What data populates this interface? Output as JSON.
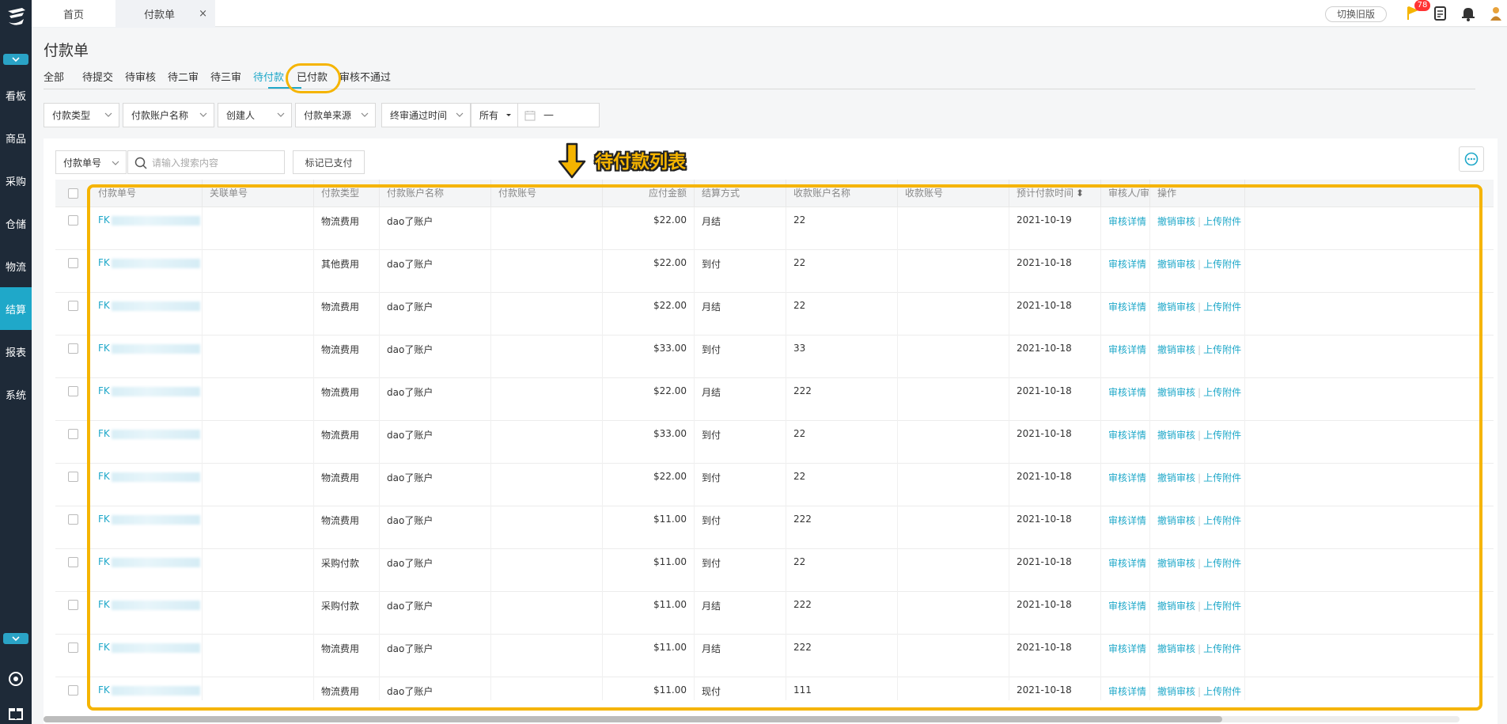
{
  "sidebar": {
    "items": [
      {
        "label": "看板",
        "active": false
      },
      {
        "label": "商品",
        "active": false
      },
      {
        "label": "采购",
        "active": false
      },
      {
        "label": "仓储",
        "active": false
      },
      {
        "label": "物流",
        "active": false
      },
      {
        "label": "结算",
        "active": true
      },
      {
        "label": "报表",
        "active": false
      },
      {
        "label": "系统",
        "active": false
      }
    ]
  },
  "topbar": {
    "tabs": [
      {
        "label": "首页"
      },
      {
        "label": "付款单",
        "closable": true
      }
    ],
    "close_glyph": "×",
    "old_version_label": "切换旧版",
    "flag_badge": "78"
  },
  "page": {
    "title": "付款单",
    "status_tabs": [
      {
        "label": "全部"
      },
      {
        "label": "待提交"
      },
      {
        "label": "待审核"
      },
      {
        "label": "待二审"
      },
      {
        "label": "待三审"
      },
      {
        "label": "待付款",
        "active": true
      },
      {
        "label": "已付款"
      },
      {
        "label": "审核不通过"
      }
    ],
    "filters": [
      "付款类型",
      "付款账户名称",
      "创建人",
      "付款单来源",
      "终审通过时间",
      "所有"
    ],
    "date_range_sep": "—"
  },
  "toolbar": {
    "search_field": "付款单号",
    "search_placeholder": "请输入搜索内容",
    "mark_paid_label": "标记已支付"
  },
  "annotation": {
    "text": "待付款列表"
  },
  "table": {
    "columns": [
      "付款单号",
      "关联单号",
      "付款类型",
      "付款账户名称",
      "付款账号",
      "应付金额",
      "结算方式",
      "收款账户名称",
      "收款账号",
      "预计付款时间",
      "审核人/审核",
      "操作"
    ],
    "sort_glyph": "⬍",
    "id_prefix": "FK",
    "actions": {
      "detail": "审核详情",
      "revoke": "撤销审核",
      "upload": "上传附件",
      "sep": "|"
    },
    "rows": [
      {
        "type": "物流费用",
        "account": "dao了账户",
        "amount": "$22.00",
        "method": "月结",
        "payee": "22",
        "date": "2021-10-19"
      },
      {
        "type": "其他费用",
        "account": "dao了账户",
        "amount": "$22.00",
        "method": "到付",
        "payee": "22",
        "date": "2021-10-18"
      },
      {
        "type": "物流费用",
        "account": "dao了账户",
        "amount": "$22.00",
        "method": "月结",
        "payee": "22",
        "date": "2021-10-18"
      },
      {
        "type": "物流费用",
        "account": "dao了账户",
        "amount": "$33.00",
        "method": "到付",
        "payee": "33",
        "date": "2021-10-18"
      },
      {
        "type": "物流费用",
        "account": "dao了账户",
        "amount": "$22.00",
        "method": "月结",
        "payee": "222",
        "date": "2021-10-18"
      },
      {
        "type": "物流费用",
        "account": "dao了账户",
        "amount": "$33.00",
        "method": "到付",
        "payee": "22",
        "date": "2021-10-18"
      },
      {
        "type": "物流费用",
        "account": "dao了账户",
        "amount": "$22.00",
        "method": "到付",
        "payee": "22",
        "date": "2021-10-18"
      },
      {
        "type": "物流费用",
        "account": "dao了账户",
        "amount": "$11.00",
        "method": "到付",
        "payee": "222",
        "date": "2021-10-18"
      },
      {
        "type": "采购付款",
        "account": "dao了账户",
        "amount": "$11.00",
        "method": "到付",
        "payee": "22",
        "date": "2021-10-18"
      },
      {
        "type": "采购付款",
        "account": "dao了账户",
        "amount": "$11.00",
        "method": "月结",
        "payee": "222",
        "date": "2021-10-18"
      },
      {
        "type": "物流费用",
        "account": "dao了账户",
        "amount": "$11.00",
        "method": "月结",
        "payee": "222",
        "date": "2021-10-18"
      },
      {
        "type": "物流费用",
        "account": "dao了账户",
        "amount": "$11.00",
        "method": "现付",
        "payee": "111",
        "date": "2021-10-18"
      }
    ]
  },
  "colors": {
    "accent": "#1fa8c9",
    "highlight": "#f5b400",
    "sidebar": "#1e2a38"
  }
}
